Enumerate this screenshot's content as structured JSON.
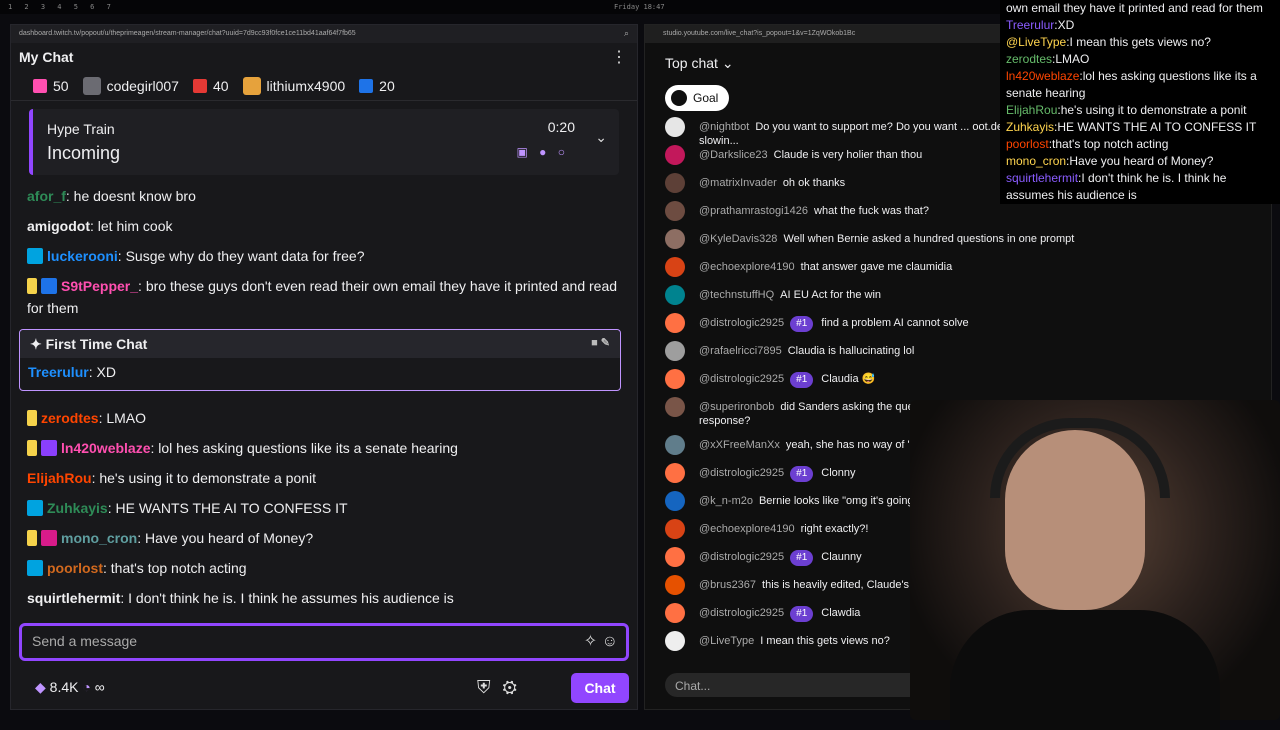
{
  "os": {
    "workspaces": "1 2 3 4 5 6 7",
    "clock": "Friday 18:47"
  },
  "twitch": {
    "url": "dashboard.twitch.tv/popout/u/theprimeagen/stream-manager/chat?uuid=7d9cc93f0fce1ce11bd41aaf64f7fb65",
    "title": "My Chat",
    "gifts": [
      {
        "count": "50"
      },
      {
        "user": "codegirl007"
      },
      {
        "count": "40"
      },
      {
        "user": "lithiumx4900"
      },
      {
        "count": "20"
      }
    ],
    "hype": {
      "label": "Hype Train",
      "status": "Incoming",
      "timer": "0:20"
    },
    "messages_top": [
      {
        "user": "afor_f",
        "color": "#2e8b57",
        "text": ": he doesnt know bro"
      },
      {
        "user": "amigodot",
        "color": "#efeff1",
        "text": ": let him cook"
      },
      {
        "user": "luckerooni",
        "color": "#1e90ff",
        "text": ": Susge why do they want data for free?"
      },
      {
        "user": "S9tPepper_",
        "color": "#ff4fb0",
        "text": ": bro these guys don't even read their own email they have it printed and read for them"
      }
    ],
    "first_time": {
      "label": "First Time Chat",
      "user": "Treerulur",
      "color": "#1e90ff",
      "text": ": XD"
    },
    "messages_bottom": [
      {
        "user": "zerodtes",
        "color": "#ff4500",
        "text": ": LMAO"
      },
      {
        "user": "ln420weblaze",
        "color": "#ff4fb0",
        "text": ": lol hes asking questions like its a senate hearing"
      },
      {
        "user": "ElijahRou",
        "color": "#ff4500",
        "text": ": he's using it to demonstrate a ponit"
      },
      {
        "user": "Zuhkayis",
        "color": "#2e8b57",
        "text": ": HE WANTS THE AI TO CONFESS IT"
      },
      {
        "user": "mono_cron",
        "color": "#5f9ea0",
        "text": ": Have you heard of Money?"
      },
      {
        "user": "poorlost",
        "color": "#d2691e",
        "text": ": that's top notch acting"
      },
      {
        "user": "squirtlehermit",
        "color": "#efeff1",
        "text": ": I don't think he is. I think he assumes his audience is"
      }
    ],
    "input_placeholder": "Send a message",
    "points": "8.4K",
    "infinity": "∞",
    "chat_button": "Chat"
  },
  "youtube": {
    "url": "studio.youtube.com/live_chat?is_popout=1&v=1ZqWOkob1Bc",
    "selector": "Top chat",
    "goal": "Goal",
    "messages": [
      {
        "name": "@nightbot",
        "text": "Do you want to support me? Do you want ... oot.dev/prime -- Taking courses is free and mine are slowin...",
        "avatar": "#e6e6e6"
      },
      {
        "name": "@Darkslice23",
        "text": "Claude is very holier than thou",
        "avatar": "#c2185b"
      },
      {
        "name": "@matrixInvader",
        "text": "oh ok thanks",
        "avatar": "#5d4037"
      },
      {
        "name": "@prathamrastogi1426",
        "text": "what the fuck was that?",
        "avatar": "#6d4c41"
      },
      {
        "name": "@KyleDavis328",
        "text": "Well when Bernie asked a hundred questions in one prompt",
        "avatar": "#8d6e63"
      },
      {
        "name": "@echoexplore4190",
        "text": "that answer gave me claumidia",
        "avatar": "#d84315"
      },
      {
        "name": "@technstuffHQ",
        "text": "AI EU Act for the win",
        "avatar": "#00838f"
      },
      {
        "name": "@distrologic2925",
        "rank": "#1",
        "text": "find a problem AI cannot solve",
        "avatar": "#ff7043"
      },
      {
        "name": "@rafaelricci7895",
        "text": "Claudia is hallucinating lol",
        "avatar": "#9e9e9e"
      },
      {
        "name": "@distrologic2925",
        "rank": "#1",
        "text": "Claudia 😅",
        "avatar": "#ff7043"
      },
      {
        "name": "@superironbob",
        "text": "did Sanders asking the question in the politician way prime the response to be politician coded in response?",
        "avatar": "#795548",
        "tall": true
      },
      {
        "name": "@xXFreeManXx",
        "text": "yeah, she has no way of \"knowing\" all that",
        "avatar": "#607d8b"
      },
      {
        "name": "@distrologic2925",
        "rank": "#1",
        "text": "Clonny",
        "avatar": "#ff7043"
      },
      {
        "name": "@k_n-m2o",
        "text": "Bernie looks like \"omg it's going to take my job\"",
        "avatar": "#1565c0"
      },
      {
        "name": "@echoexplore4190",
        "text": "right exactly?!",
        "avatar": "#d84315"
      },
      {
        "name": "@distrologic2925",
        "rank": "#1",
        "text": "Claunny",
        "avatar": "#ff7043"
      },
      {
        "name": "@brus2367",
        "text": "this is heavily edited, Claude's voice mo...",
        "avatar": "#e65100"
      },
      {
        "name": "@distrologic2925",
        "rank": "#1",
        "text": "Clawdia",
        "avatar": "#ff7043"
      },
      {
        "name": "@LiveType",
        "text": "I mean this gets views no?",
        "avatar": "#eeeeee"
      }
    ],
    "input_placeholder": "Chat..."
  },
  "overlay": [
    {
      "user": "",
      "color": "#efeff1",
      "text": "own email they have it printed and read for them"
    },
    {
      "user": "Treerulur",
      "color": "#8a5cff",
      "text": ":XD"
    },
    {
      "user": "@LiveType",
      "color": "#ffd54f",
      "text": ":I mean this gets views no?"
    },
    {
      "user": "zerodtes",
      "color": "#66bb6a",
      "text": ":LMAO"
    },
    {
      "user": "ln420weblaze",
      "color": "#ff4500",
      "text": ":lol hes asking questions like its a senate hearing"
    },
    {
      "user": "ElijahRou",
      "color": "#66bb6a",
      "text": ":he's using it to demonstrate a ponit"
    },
    {
      "user": "Zuhkayis",
      "color": "#ffd54f",
      "text": ":HE WANTS THE AI TO CONFESS IT"
    },
    {
      "user": "poorlost",
      "color": "#ff4500",
      "text": ":that's top notch acting"
    },
    {
      "user": "mono_cron",
      "color": "#ffd54f",
      "text": ":Have you heard of Money?"
    },
    {
      "user": "squirtlehermit",
      "color": "#8a5cff",
      "text": ":I don't think he is. I think he assumes his audience is"
    }
  ]
}
